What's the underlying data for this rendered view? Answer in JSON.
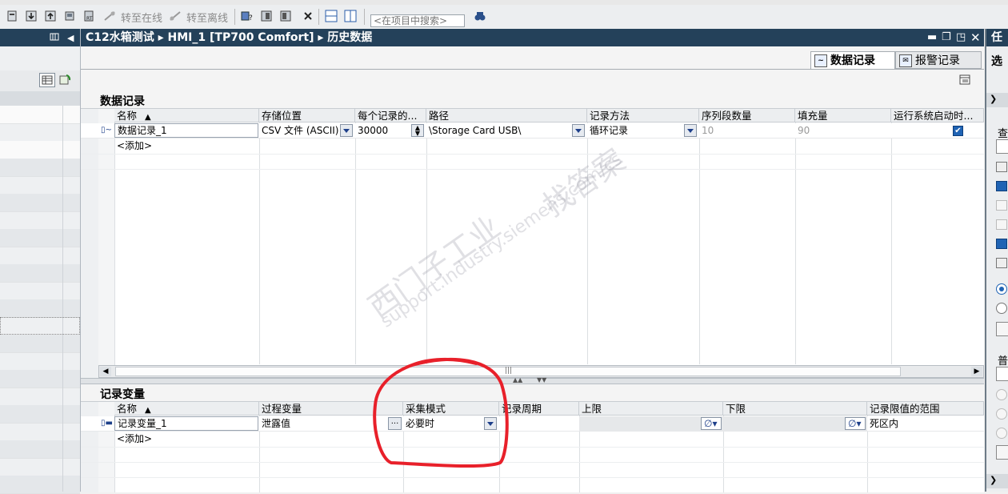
{
  "toolbar": {
    "go_online": "转至在线",
    "go_offline": "转至离线",
    "search_placeholder": "<在项目中搜索>"
  },
  "titlebar": {
    "breadcrumb": "C12水箱测试 ▸ HMI_1 [TP700 Comfort] ▸ 历史数据"
  },
  "tabs": [
    {
      "label": "数据记录",
      "active": true
    },
    {
      "label": "报警记录",
      "active": false
    }
  ],
  "right_panel": {
    "title_glyph": "任",
    "tab_glyph": "选",
    "label1": "查",
    "label2": "普"
  },
  "data_logs": {
    "title": "数据记录",
    "columns": [
      "名称",
      "存储位置",
      "每个记录的...",
      "路径",
      "记录方法",
      "序列段数量",
      "填充量",
      "运行系统启动时..."
    ],
    "rows": [
      {
        "name": "数据记录_1",
        "storage": "CSV 文件 (ASCII)",
        "records": "30000",
        "path": "\\Storage Card USB\\",
        "method": "循环记录",
        "segments": "10",
        "fill": "90",
        "enable_on_start": true
      }
    ],
    "add_label": "<添加>"
  },
  "log_tags": {
    "title": "记录变量",
    "columns": [
      "名称",
      "过程变量",
      "采集模式",
      "记录周期",
      "上限",
      "下限",
      "记录限值的范围"
    ],
    "rows": [
      {
        "name": "记录变量_1",
        "process_tag": "泄露值",
        "acq_mode": "必要时",
        "cycle": "",
        "high": "",
        "low": "",
        "limit_range": "死区内"
      }
    ],
    "add_label": "<添加>"
  },
  "watermark": {
    "line1": "西门子工业",
    "line2": "找答案",
    "line3": "support.industry.siemens.com/cs"
  },
  "colors": {
    "title_bar": "#24415a",
    "annotation": "#e8202a",
    "checkbox": "#1f63b4"
  }
}
